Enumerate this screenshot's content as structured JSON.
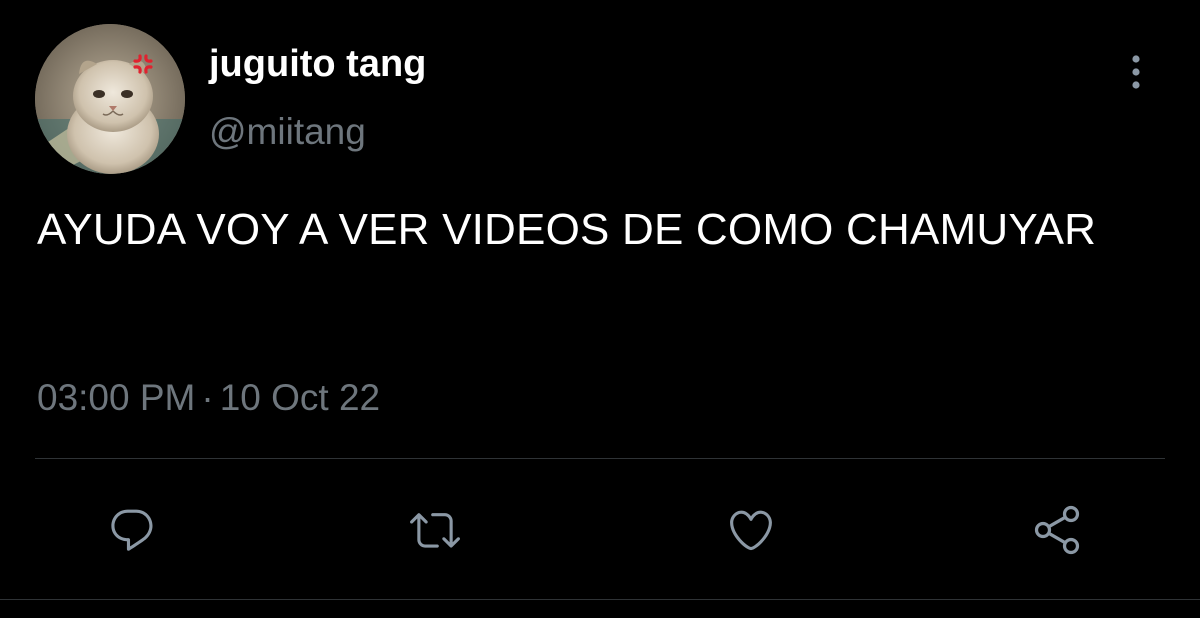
{
  "author": {
    "display_name": "juguito tang",
    "handle": "@miitang",
    "avatar_icon": "kitten-avatar"
  },
  "tweet": {
    "text": "AYUDA VOY A VER VIDEOS DE COMO CHAMUYAR",
    "time": "03:00 PM",
    "separator": "·",
    "date": "10 Oct 22"
  },
  "actions": {
    "more_icon": "more-vertical-icon",
    "reply_icon": "reply-icon",
    "retweet_icon": "retweet-icon",
    "like_icon": "heart-icon",
    "share_icon": "share-icon"
  },
  "colors": {
    "background": "#000000",
    "primary_text": "#ffffff",
    "secondary_text": "#6e767d",
    "divider": "#2f3336",
    "icon": "#8b98a5"
  }
}
